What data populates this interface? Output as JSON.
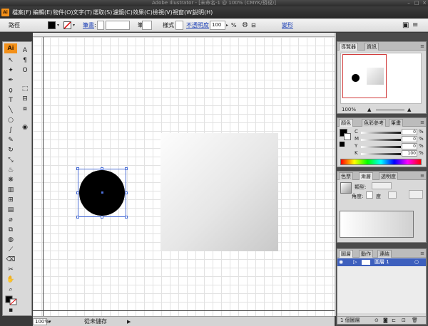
{
  "window": {
    "title": "Adobe Illustrator - [未命名-1 @ 100% (CMYK/預視)]"
  },
  "menu": {
    "app_icon": "Ai",
    "items": [
      "檔案(F)",
      "編輯(E)",
      "物件(O)",
      "文字(T)",
      "選取(S)",
      "濾鏡(C)",
      "效果(C)",
      "檢視(V)",
      "視窗(W)",
      "說明(H)"
    ]
  },
  "control": {
    "selection_label": "路徑",
    "fill_color": "#000000",
    "stroke_color": "none",
    "stroke_link": "筆畫",
    "brush_label": "筆刷",
    "style_label": "樣式",
    "opacity_link": "不透明度",
    "opacity_value": "100",
    "percent": "%",
    "transform_link": "變形"
  },
  "toolbox": {
    "logo": "Ai",
    "tools": [
      "selection-tool",
      "direct-selection-tool",
      "magic-wand-tool",
      "lasso-tool",
      "pen-tool",
      "type-tool",
      "line-tool",
      "rectangle-tool",
      "paintbrush-tool",
      "pencil-tool",
      "rotate-tool",
      "scale-tool",
      "warp-tool",
      "free-transform-tool",
      "symbol-sprayer-tool",
      "graph-tool",
      "mesh-tool",
      "gradient-tool",
      "eyedropper-tool",
      "blend-tool",
      "live-paint-tool",
      "slice-tool",
      "eraser-tool",
      "scissors-tool",
      "hand-tool",
      "zoom-tool"
    ]
  },
  "canvas": {
    "objects": [
      "circle-black",
      "square-gradient"
    ]
  },
  "status": {
    "zoom": "100%",
    "status_text": "從未儲存"
  },
  "panels": {
    "navigator": {
      "tabs": [
        "導覽器",
        "資訊"
      ],
      "zoom": "100%"
    },
    "color": {
      "tabs": [
        "顏色",
        "色彩參考",
        "筆畫"
      ],
      "sliders": [
        {
          "label": "C",
          "value": "0"
        },
        {
          "label": "M",
          "value": "0"
        },
        {
          "label": "Y",
          "value": "0"
        },
        {
          "label": "K",
          "value": "100"
        }
      ],
      "percent": "%"
    },
    "gradient": {
      "tabs": [
        "色票",
        "漸層",
        "透明度"
      ],
      "type_label": "類型:",
      "angle_label": "角度:",
      "angle_unit": "度"
    },
    "layers": {
      "tabs": [
        "圖層",
        "動作",
        "連結"
      ],
      "layer_name": "圖層 1",
      "count_label": "1 個圖層"
    }
  }
}
